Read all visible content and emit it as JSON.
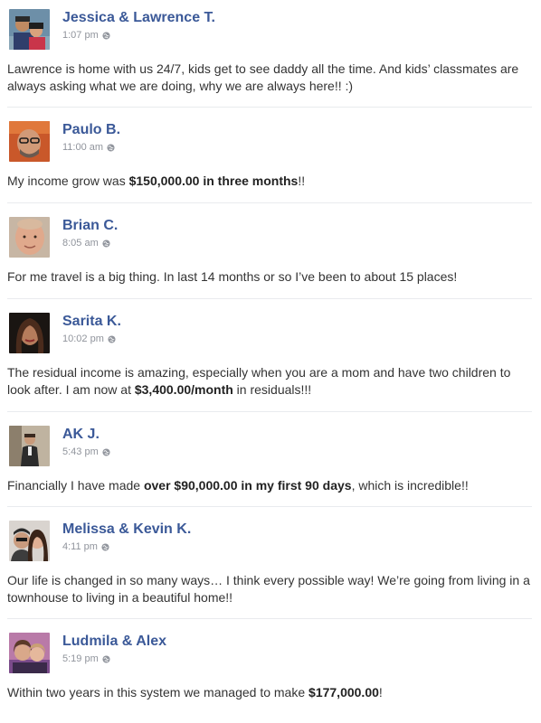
{
  "colors": {
    "name": "#3b5998",
    "meta": "#90949c",
    "text": "#333333",
    "divider": "#e9ebee"
  },
  "posts": [
    {
      "author": "Jessica & Lawrence T.",
      "time": "1:07 pm",
      "privacy_icon": "globe-icon",
      "text": [
        {
          "t": "Lawrence is home with us 24/7, kids get to see daddy all the time. And kids’ classmates are always asking what we are doing, why we are always here!! :)",
          "b": false
        }
      ]
    },
    {
      "author": "Paulo B.",
      "time": "11:00 am",
      "privacy_icon": "globe-icon",
      "text": [
        {
          "t": "My income grow was ",
          "b": false
        },
        {
          "t": "$150,000.00 in three months",
          "b": true
        },
        {
          "t": "!!",
          "b": false
        }
      ]
    },
    {
      "author": "Brian C.",
      "time": "8:05 am",
      "privacy_icon": "globe-icon",
      "text": [
        {
          "t": "For me travel is a big thing. In last 14 months or so I’ve been to about 15 places!",
          "b": false
        }
      ]
    },
    {
      "author": "Sarita K.",
      "time": "10:02 pm",
      "privacy_icon": "globe-icon",
      "text": [
        {
          "t": "The residual income is amazing, especially when you are a mom and have two children to look after. I am now at ",
          "b": false
        },
        {
          "t": "$3,400.00/month",
          "b": true
        },
        {
          "t": " in residuals!!!",
          "b": false
        }
      ]
    },
    {
      "author": "AK J.",
      "time": "5:43 pm",
      "privacy_icon": "globe-icon",
      "text": [
        {
          "t": "Financially I have made ",
          "b": false
        },
        {
          "t": "over $90,000.00 in my first 90 days",
          "b": true
        },
        {
          "t": ", which is incredible!!",
          "b": false
        }
      ]
    },
    {
      "author": "Melissa & Kevin K.",
      "time": "4:11 pm",
      "privacy_icon": "globe-icon",
      "text": [
        {
          "t": "Our life is changed in so many ways… I think every possible way! We’re going from living in a townhouse to living in a beautiful home!!",
          "b": false
        }
      ]
    },
    {
      "author": "Ludmila & Alex",
      "time": "5:19 pm",
      "privacy_icon": "globe-icon",
      "text": [
        {
          "t": "Within two years in this system we managed to make ",
          "b": false
        },
        {
          "t": "$177,000.00",
          "b": true
        },
        {
          "t": "!",
          "b": false
        }
      ]
    }
  ]
}
